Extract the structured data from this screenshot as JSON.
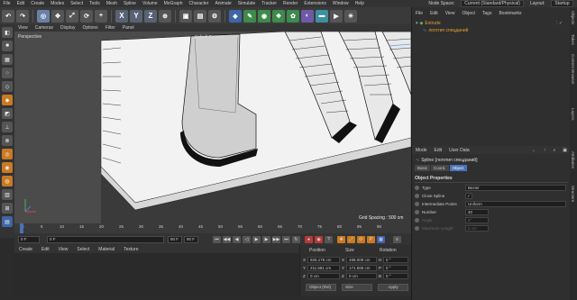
{
  "app": {
    "menu": [
      "File",
      "Edit",
      "Create",
      "Modes",
      "Select",
      "Tools",
      "Mesh",
      "Spline",
      "Volume",
      "MoGraph",
      "Character",
      "Animate",
      "Simulate",
      "Tracker",
      "Render",
      "Extensions",
      "Window",
      "Help"
    ],
    "node_space_label": "Node Space:",
    "node_space_value": "Current (Standard/Physical)",
    "layout_label": "Layout:",
    "layout_value": "Startup"
  },
  "toolbar": {
    "axis_x": "X",
    "axis_y": "Y",
    "axis_z": "Z"
  },
  "viewport": {
    "menu": [
      "View",
      "Cameras",
      "Display",
      "Options",
      "Filter",
      "Panel"
    ],
    "camera_label": "Perspective",
    "object_tag_label": "Default Camera",
    "grid_spacing": "Grid Spacing : 500 cm"
  },
  "timeline": {
    "ticks": [
      "0",
      "5",
      "10",
      "15",
      "20",
      "25",
      "30",
      "35",
      "40",
      "45",
      "50",
      "55",
      "60",
      "65",
      "70",
      "75",
      "80",
      "85",
      "90"
    ],
    "current_frame": "0 F",
    "start_frame": "0 F",
    "end_frame": "90 F",
    "end_frame_2": "90 F",
    "current_frame_display": "0 F"
  },
  "material_manager": {
    "menu": [
      "Create",
      "Edit",
      "View",
      "Select",
      "Material",
      "Texture"
    ]
  },
  "coordinates": {
    "headers": [
      "Position",
      "Size",
      "Rotation"
    ],
    "rows": [
      {
        "axis": "X",
        "pos": "826.178 cm",
        "size_axis": "X",
        "size": "498.009 cm",
        "rot_axis": "H",
        "rot": "0 °"
      },
      {
        "axis": "Y",
        "pos": "211.581 cm",
        "size_axis": "Y",
        "size": "171.569 cm",
        "rot_axis": "P",
        "rot": "0 °"
      },
      {
        "axis": "Z",
        "pos": "0 cm",
        "size_axis": "Z",
        "size": "0 cm",
        "rot_axis": "B",
        "rot": "0 °"
      }
    ],
    "mode_select": "Object (Rel)",
    "size_select": "Size",
    "apply_label": "Apply"
  },
  "object_manager": {
    "menu": [
      "File",
      "Edit",
      "View",
      "Object",
      "Tags",
      "Bookmarks"
    ],
    "objects": [
      {
        "name": "Extrude",
        "color": "#e0a030"
      },
      {
        "name": "логотип спецданий",
        "color": "#e0a030"
      }
    ]
  },
  "attribute_manager": {
    "menu": [
      "Mode",
      "Edit",
      "User Data"
    ],
    "title": "Spline [логотип спецданий]",
    "tabs": [
      "Basic",
      "Coord.",
      "Object"
    ],
    "active_tab": "Object",
    "section": "Object Properties",
    "props": [
      {
        "label": "Type",
        "value": "Bezier"
      },
      {
        "label": "Close Spline",
        "value": "✓"
      },
      {
        "label": "Intermediate Points",
        "value": "Uniform"
      },
      {
        "label": "Number",
        "value": "40"
      },
      {
        "label": "Angle",
        "value": "5°"
      },
      {
        "label": "Maximum Length",
        "value": "5 cm"
      }
    ]
  },
  "side_tabs": [
    "Objects",
    "Takes",
    "Content Browser",
    "Layers",
    "Attributes",
    "Structure"
  ],
  "colors": {
    "accent": "#4a70b8",
    "orange": "#c87a22"
  }
}
